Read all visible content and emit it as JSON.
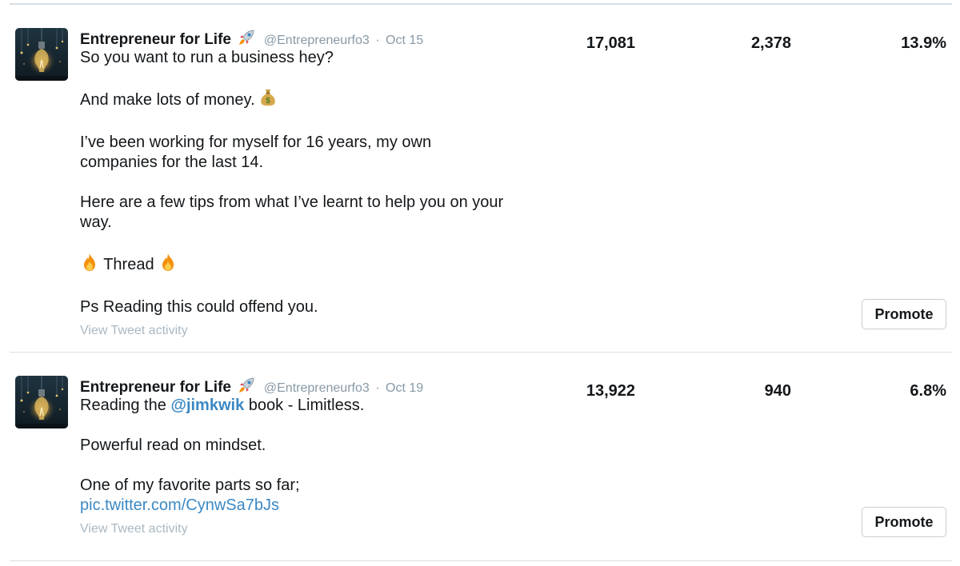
{
  "tweets": [
    {
      "author": "Entrepreneur for Life",
      "handle": "@Entrepreneurfo3",
      "separator": "·",
      "date": "Oct 15",
      "paragraphs": [
        "So you want to run a business hey?",
        "And make lots of money.",
        "I’ve been working for myself for 16 years, my own companies for the last 14.",
        "Here are a few tips from what I’ve learnt to help you on your way.",
        "Thread",
        "Ps Reading this could offend you."
      ],
      "view_activity": "View Tweet activity",
      "impressions": "17,081",
      "engagements": "2,378",
      "engagement_rate": "13.9%",
      "promote_label": "Promote"
    },
    {
      "author": "Entrepreneur for Life",
      "handle": "@Entrepreneurfo3",
      "separator": "·",
      "date": "Oct 19",
      "text_before_mention": "Reading the",
      "mention": "@jimkwik",
      "text_after_mention": "book - Limitless.",
      "paragraph_2": "Powerful read on mindset.",
      "paragraph_3": "One of my favorite parts so far;",
      "link": "pic.twitter.com/CynwSa7bJs",
      "view_activity": "View Tweet activity",
      "impressions": "13,922",
      "engagements": "940",
      "engagement_rate": "6.8%",
      "promote_label": "Promote"
    }
  ],
  "icons": {
    "avatar": "lightbulb-avatar",
    "verified_emoji": "rocket-icon",
    "money": "money-bag-icon",
    "fire": "fire-icon"
  },
  "colors": {
    "link": "#3b88c3",
    "muted": "#8899a6",
    "faint": "#aab8c2",
    "divider": "#d8dee3"
  }
}
